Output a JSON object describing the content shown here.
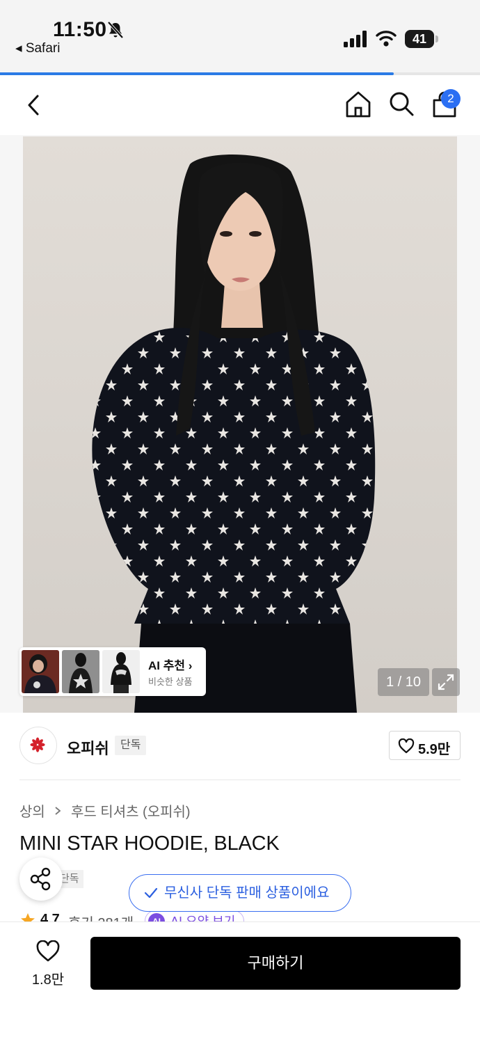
{
  "status_bar": {
    "time": "11:50",
    "back_app": "◂ Safari",
    "battery": "41"
  },
  "browser": {
    "load_progress": 0.82
  },
  "nav": {
    "cart_count": "2"
  },
  "gallery": {
    "page_indicator": "1 / 10",
    "ai_card": {
      "title": "AI 추천 ›",
      "subtitle": "비슷한 상품"
    }
  },
  "brand": {
    "name": "오피쉬",
    "tag": "단독",
    "like_count": "5.9만"
  },
  "product": {
    "breadcrumb": [
      "상의",
      "후드 티셔츠 (오피쉬)"
    ],
    "title": "MINI STAR HOODIE, BLACK",
    "tag": "단독",
    "rating": "4.7",
    "reviews": "후기 281개",
    "ai_summary_badge": "AI",
    "ai_summary": "AI 요약 보기"
  },
  "toast": {
    "text": "무신사 단독 판매 상품이에요"
  },
  "bottom_bar": {
    "like_count": "1.8만",
    "buy_label": "구매하기"
  },
  "colors": {
    "accent_blue": "#2b6ff3",
    "ai_purple": "#7b4de0",
    "buy_black": "#000000"
  }
}
